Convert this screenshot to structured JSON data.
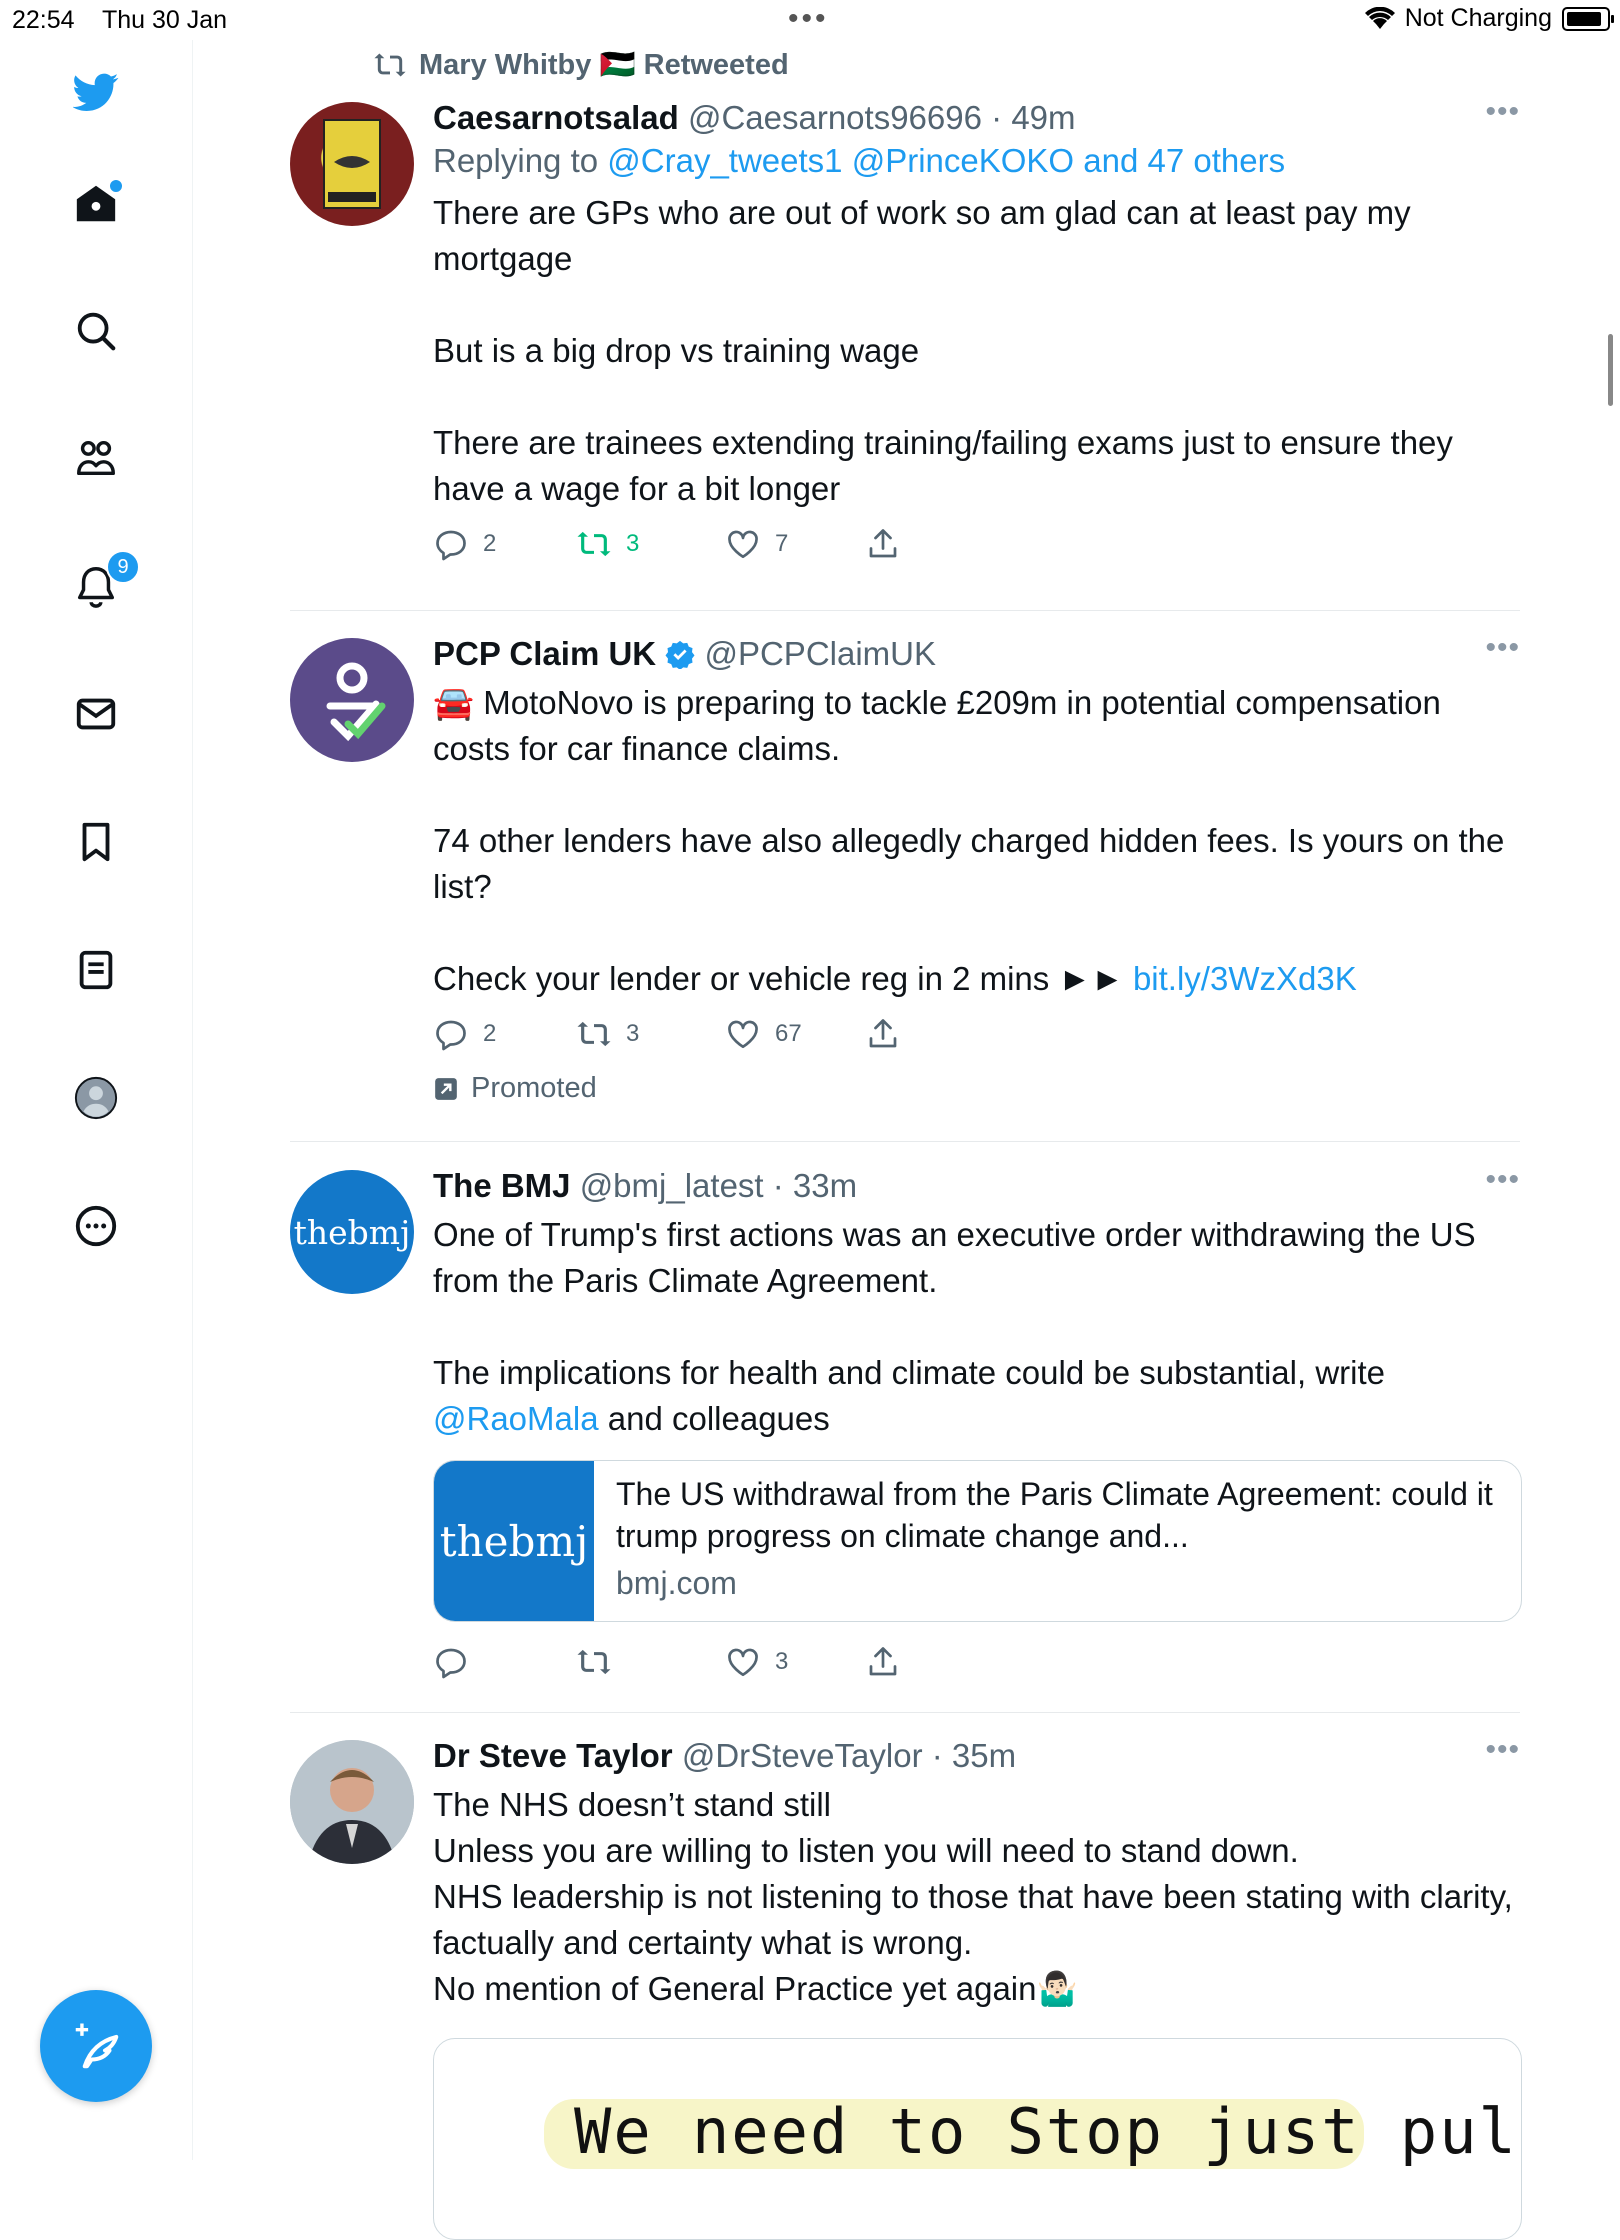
{
  "status_bar": {
    "time": "22:54",
    "date": "Thu 30 Jan",
    "charging": "Not Charging"
  },
  "sidebar": {
    "notifications_count": "9"
  },
  "tweets": [
    {
      "social_context": "Mary Whitby 🇵🇸 Retweeted",
      "name": "Caesarnotsalad",
      "handle": "@Caesarnots96696",
      "time": "49m",
      "replying_prefix": "Replying to",
      "replying_to": "@Cray_tweets1 @PrinceKOKO and 47 others",
      "text": "There are GPs who are out of work so am glad can at least pay my mortgage\n\nBut is a big drop vs training wage\n\nThere are trainees extending training/failing exams just to ensure they have a wage for a bit longer",
      "replies": "2",
      "retweets": "3",
      "likes": "7"
    },
    {
      "name": "PCP Claim UK",
      "handle": "@PCPClaimUK",
      "text": "🚘 MotoNovo is preparing to tackle £209m in potential compensation costs for car finance claims.\n\n74 other lenders have also allegedly charged hidden fees. Is yours on the list?\n\nCheck your lender or vehicle reg in 2 mins ►► ",
      "link": "bit.ly/3WzXd3K",
      "replies": "2",
      "retweets": "3",
      "likes": "67",
      "promoted": "Promoted"
    },
    {
      "name": "The BMJ",
      "handle": "@bmj_latest",
      "time": "33m",
      "avatar_text": "thebmj",
      "text": "One of Trump's first actions was an executive order withdrawing the US from the Paris Climate Agreement.\n\nThe implications for health and climate could be substantial, write ",
      "mention": "@RaoMala",
      "text_after": " and colleagues",
      "card_title": "The US withdrawal from the Paris Climate Agreement: could it trump progress on climate change and...",
      "card_site": "bmj.com",
      "card_thumb": "thebmj",
      "likes": "3"
    },
    {
      "name": "Dr Steve Taylor",
      "handle": "@DrSteveTaylor",
      "time": "35m",
      "text": "The NHS doesn’t stand still\nUnless you are willing to listen you will need to stand down.\nNHS leadership is not listening to those that have been stating with clarity, factually and certainty what is wrong.\nNo mention of General Practice yet again🤷🏻‍♂️",
      "image_text": "We need to Stop just pulling"
    }
  ],
  "colors": {
    "accent": "#1d9bf0",
    "retweet_green": "#00ba7c",
    "secondary_text": "#536471"
  }
}
